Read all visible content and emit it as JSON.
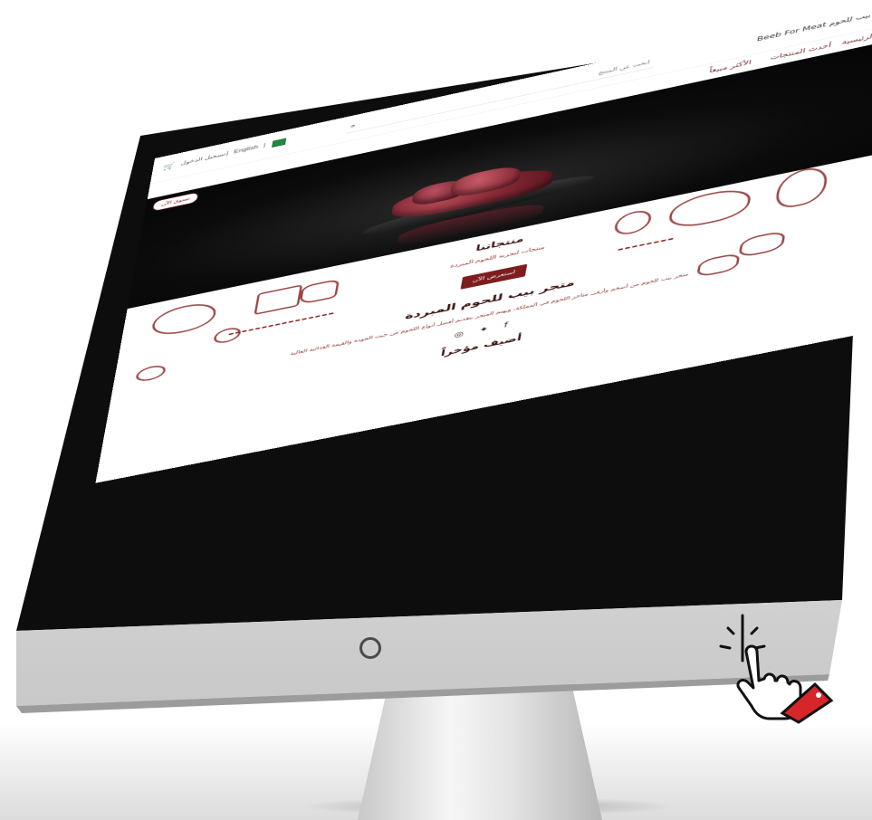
{
  "colors": {
    "brand": "#8a2424",
    "brand_dark": "#7d1d1d",
    "title": "#3a1010",
    "flag": "#1f8a3e"
  },
  "header": {
    "brand_name": "Beeb For Meat بيب للحوم",
    "search_placeholder": "ابحث عن المنتج",
    "cart_icon": "cart-icon",
    "login_label": "تسجيل الدخول",
    "language_label": "English",
    "separator": "|"
  },
  "nav": {
    "home": "الصفحة الرئيسية",
    "latest_products": "أحدث المنتجات",
    "best_selling": "الأكثر مبيعاً"
  },
  "shop_button": "تسوق الآن",
  "products_section": {
    "title": "منتجاتنا",
    "subtitle": "منتجات لتجربة اللحوم المبردة",
    "cta": "استعرض الآن"
  },
  "store_section": {
    "title": "متجر بيب للحوم المبردة",
    "description": "متجر بيب للحوم من أضخم وأرقى متاجر اللحوم في المملكة، ويهتم المتجر بتقديم أفضل أنواع اللحوم من حيث الجودة والقيمة الغذائية العالية"
  },
  "socials": [
    "instagram-icon",
    "twitter-icon",
    "facebook-icon"
  ],
  "recent_section": {
    "title": "أضيف مؤخراً"
  }
}
